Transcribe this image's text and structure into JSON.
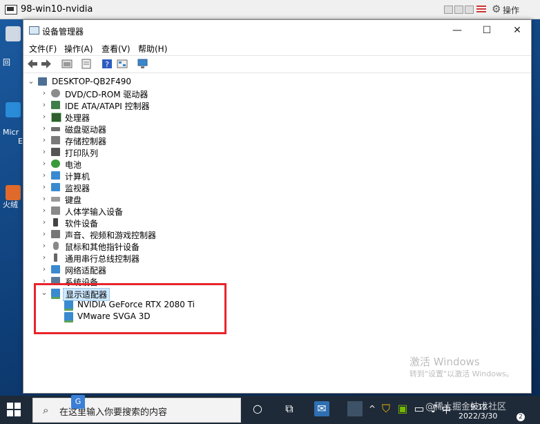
{
  "vm_window": {
    "title": "98-win10-nvidia",
    "ops_label": "操作"
  },
  "desktop": {
    "labels": [
      "回",
      "Micr",
      "E",
      "火绒"
    ]
  },
  "device_manager": {
    "title": "设备管理器",
    "menu": [
      "文件(F)",
      "操作(A)",
      "查看(V)",
      "帮助(H)"
    ],
    "window_controls": {
      "minimize": "—",
      "maximize": "☐",
      "close": "✕"
    },
    "tree": {
      "root": "DESKTOP-QB2F490",
      "categories": [
        "DVD/CD-ROM 驱动器",
        "IDE ATA/ATAPI 控制器",
        "处理器",
        "磁盘驱动器",
        "存储控制器",
        "打印队列",
        "电池",
        "计算机",
        "监视器",
        "键盘",
        "人体学输入设备",
        "软件设备",
        "声音、视频和游戏控制器",
        "鼠标和其他指针设备",
        "通用串行总线控制器",
        "网络适配器",
        "系统设备"
      ],
      "expanded": {
        "label": "显示适配器",
        "children": [
          "NVIDIA GeForce RTX 2080 Ti",
          "VMware SVGA 3D"
        ]
      }
    }
  },
  "watermark": {
    "title": "激活 Windows",
    "subtitle": "转到\"设置\"以激活 Windows。"
  },
  "taskbar": {
    "search_placeholder": "在这里输入你要搜索的内容",
    "ime_badge": "G",
    "language": "中",
    "time": "9:12",
    "date": "2022/3/30",
    "notification_count": "2",
    "site_watermark": "@稀土掘金技术社区"
  },
  "colors": {
    "highlight": "#e8232a",
    "selection": "#cce8ff",
    "taskbar": "#1e2a38"
  }
}
